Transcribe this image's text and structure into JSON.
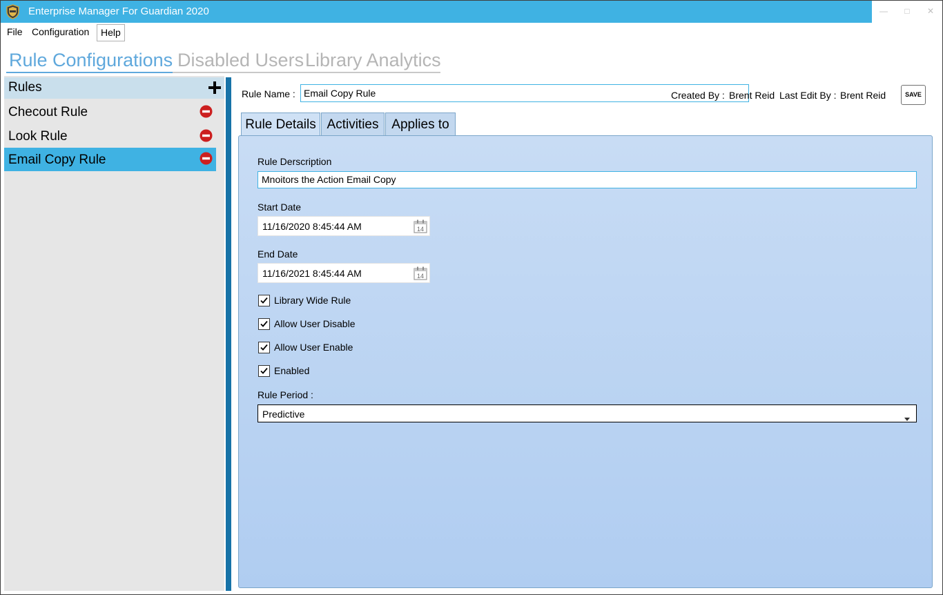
{
  "window": {
    "title": "Enterprise Manager For Guardian 2020"
  },
  "menu": {
    "items": [
      "File",
      "Configuration",
      "Help"
    ]
  },
  "main_tabs": [
    "Rule Configurations",
    "Disabled Users",
    "Library Analytics"
  ],
  "rules": {
    "header": "Rules",
    "items": [
      "Checout Rule",
      "Look Rule",
      "Email Copy Rule"
    ],
    "selected_index": 2
  },
  "rule": {
    "name_label": "Rule Name :",
    "name_value": "Email Copy Rule",
    "created_by_label": "Created By :",
    "created_by": "Brent Reid",
    "last_edit_label": "Last Edit By :",
    "last_edit_by": "Brent Reid",
    "save_label": "SAVE"
  },
  "detail_tabs": [
    "Rule Details",
    "Activities",
    "Applies to"
  ],
  "details": {
    "description_label": "Rule Derscription",
    "description_value": "Mnoitors the Action Email Copy",
    "start_label": "Start Date",
    "start_value": "11/16/2020 8:45:44 AM",
    "end_label": "End Date",
    "end_value": "11/16/2021 8:45:44 AM",
    "calendar_day": "14",
    "checkboxes": [
      {
        "label": "Library Wide Rule",
        "checked": true
      },
      {
        "label": "Allow User Disable",
        "checked": true
      },
      {
        "label": "Allow User Enable",
        "checked": true
      },
      {
        "label": "Enabled",
        "checked": true
      }
    ],
    "period_label": "Rule Period :",
    "period_value": "Predictive"
  },
  "colors": {
    "accent": "#3fb2e3",
    "splitter": "#1773a8",
    "delete_red": "#cc1f1f",
    "tab_selected_text": "#5fa8dc",
    "tab_inactive_text": "#b5b5b5"
  },
  "icons": {
    "app": "guardian-shield-icon",
    "add": "plus-icon",
    "delete": "minus-circle-icon",
    "calendar": "calendar-icon",
    "dropdown": "chevron-down-icon"
  }
}
